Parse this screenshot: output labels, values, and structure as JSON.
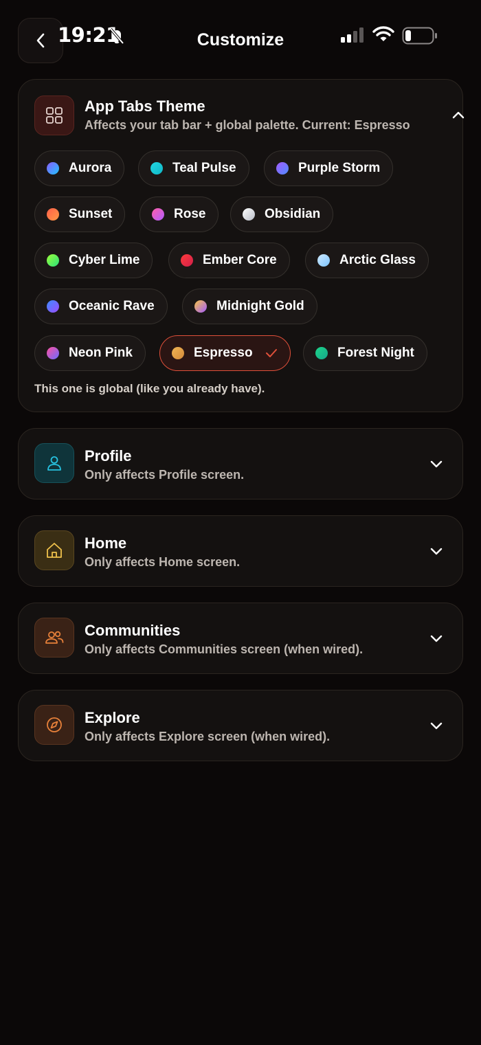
{
  "status_bar": {
    "time": "19:21"
  },
  "header": {
    "title": "Customize"
  },
  "app_tabs": {
    "title": "App Tabs Theme",
    "subtitle": "Affects your tab bar + global palette. Current: Espresso",
    "themes": [
      {
        "label": "Aurora",
        "color_a": "#8a5cff",
        "color_b": "#1fc3ff"
      },
      {
        "label": "Teal Pulse",
        "color_a": "#21d6e0",
        "color_b": "#10b8c8"
      },
      {
        "label": "Purple Storm",
        "color_a": "#a35bff",
        "color_b": "#4f8bff"
      },
      {
        "label": "Sunset",
        "color_a": "#ff5f4a",
        "color_b": "#ff9a45"
      },
      {
        "label": "Rose",
        "color_a": "#ff5fa8",
        "color_b": "#b15cff"
      },
      {
        "label": "Obsidian",
        "color_a": "#ffffff",
        "color_b": "#b8bcc6"
      },
      {
        "label": "Cyber Lime",
        "color_a": "#9dff3a",
        "color_b": "#28e07a"
      },
      {
        "label": "Ember Core",
        "color_a": "#ff3b3b",
        "color_b": "#d11f4a"
      },
      {
        "label": "Arctic Glass",
        "color_a": "#cfe9ff",
        "color_b": "#7cc4ff"
      },
      {
        "label": "Oceanic Rave",
        "color_a": "#3d8bff",
        "color_b": "#9c4dff"
      },
      {
        "label": "Midnight Gold",
        "color_a": "#f6c445",
        "color_b": "#a45cff"
      },
      {
        "label": "Neon Pink",
        "color_a": "#ff4fa0",
        "color_b": "#6a6cff"
      },
      {
        "label": "Espresso",
        "color_a": "#f1b554",
        "color_b": "#d38a3a"
      },
      {
        "label": "Forest Night",
        "color_a": "#1cd68a",
        "color_b": "#16a58a"
      }
    ],
    "selected": "Espresso",
    "footnote": "This one is global (like you already have)."
  },
  "sections": [
    {
      "title": "Profile",
      "subtitle": "Only affects Profile screen.",
      "icon": "person-icon",
      "accent": "#27c1e0"
    },
    {
      "title": "Home",
      "subtitle": "Only affects Home screen.",
      "icon": "house-icon",
      "accent": "#f0c24c"
    },
    {
      "title": "Communities",
      "subtitle": "Only affects Communities screen (when wired).",
      "icon": "people-icon",
      "accent": "#e8813a"
    },
    {
      "title": "Explore",
      "subtitle": "Only affects Explore screen (when wired).",
      "icon": "compass-icon",
      "accent": "#e8813a"
    }
  ]
}
